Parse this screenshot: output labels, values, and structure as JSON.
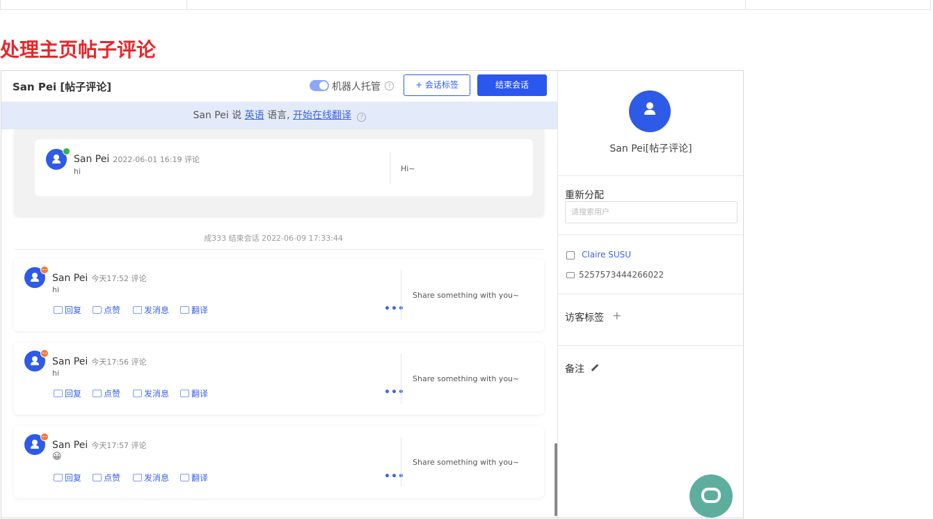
{
  "page": {
    "heading": "处理主页帖子评论"
  },
  "chat": {
    "title": "San Pei [帖子评论]",
    "robot_label": "机器人托管",
    "help_symbol": "?",
    "tag_button": "+ 会话标签",
    "end_button": "结束会话",
    "translation": {
      "prefix": "San Pei 说 ",
      "language": "英语",
      "middle": " 语言, ",
      "action": "开始在线翻译"
    },
    "history_comment": {
      "user": "San Pei",
      "meta": "2022-06-01 16:19 评论",
      "text": "hi",
      "reply": "Hi~"
    },
    "ended_notice": "成333 结束会话 2022-06-09 17:33:44",
    "actions": {
      "reply": "回复",
      "like": "点赞",
      "message": "发消息",
      "translate": "翻译",
      "more": "•••"
    },
    "posts": [
      {
        "user": "San Pei",
        "meta": "今天17:52 评论",
        "text": "hi",
        "post_text": "Share something with you~"
      },
      {
        "user": "San Pei",
        "meta": "今天17:56 评论",
        "text": "hi",
        "post_text": "Share something with you~"
      },
      {
        "user": "San Pei",
        "meta": "今天17:57 评论",
        "text": "😀",
        "post_text": "Share something with you~"
      }
    ]
  },
  "sidebar": {
    "visitor_name": "San Pei[帖子评论]",
    "reassign_label": "重新分配",
    "reassign_placeholder": "请搜索用户",
    "agent_name": "Claire SUSU",
    "visitor_id": "5257573444266022",
    "visitor_tags_label": "访客标签",
    "add_symbol": "+",
    "notes_label": "备注"
  },
  "colors": {
    "accent": "#2a58ee",
    "heading": "#e8262b",
    "translate_bar": "#e3eaf9",
    "fab": "#5dae9e"
  }
}
